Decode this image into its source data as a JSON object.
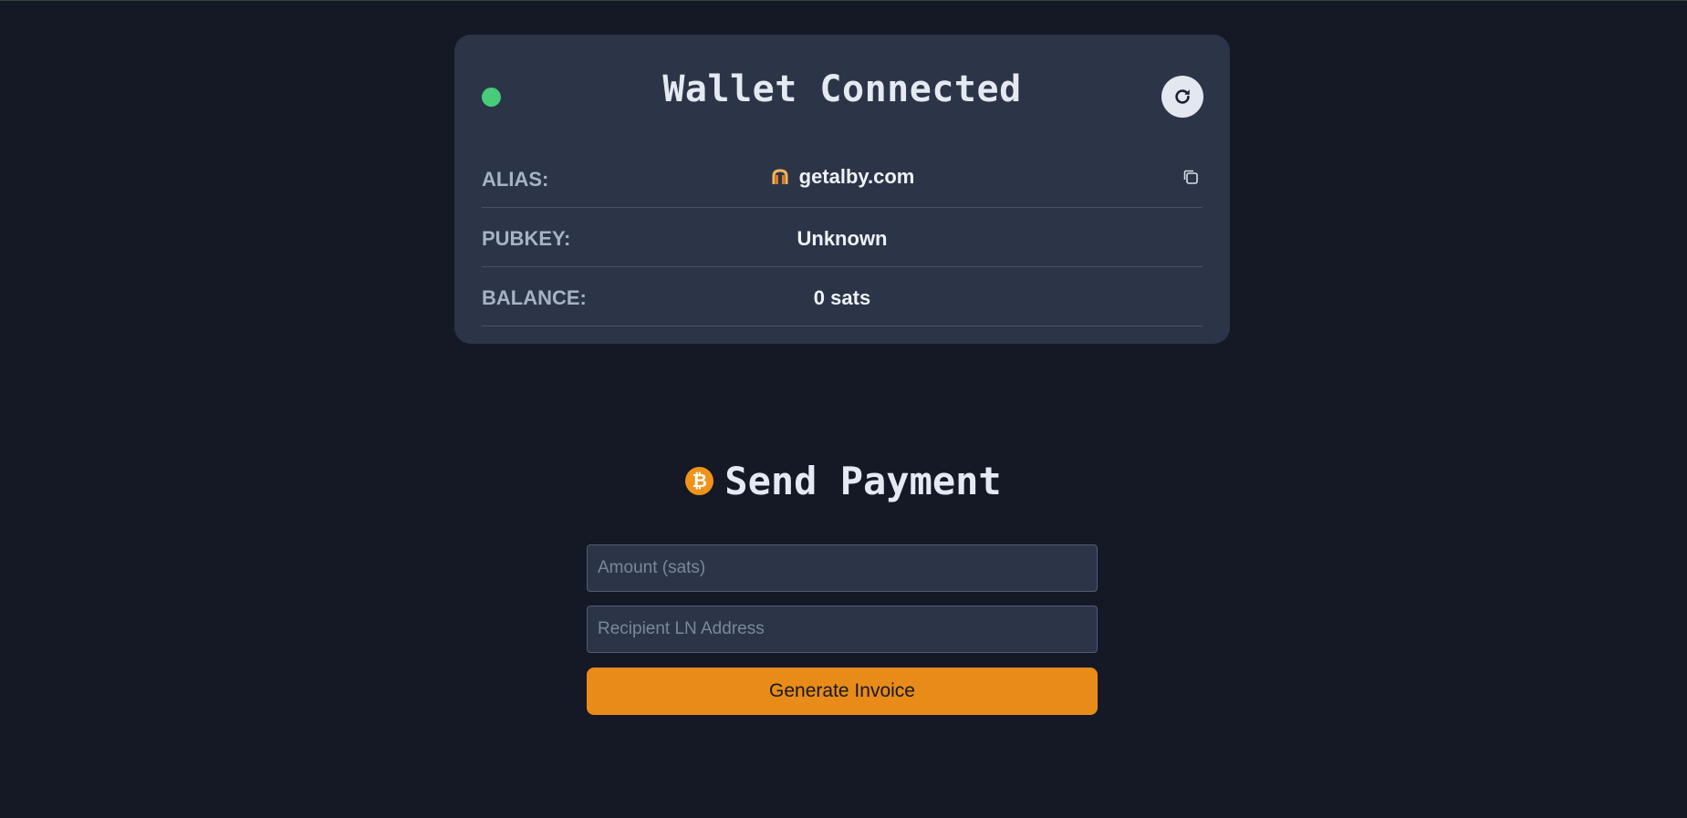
{
  "wallet": {
    "status": "connected",
    "title": "Wallet Connected",
    "status_color": "#47cc79",
    "refresh_icon": "refresh-icon",
    "rows": [
      {
        "label": "ALIAS:",
        "value": "getalby.com",
        "icon": "alby-logo-icon",
        "copy_icon": "copy-icon"
      },
      {
        "label": "PUBKEY:",
        "value": "Unknown"
      },
      {
        "label": "BALANCE:",
        "value": "0 sats"
      }
    ]
  },
  "send": {
    "title": "Send Payment",
    "icon": "bitcoin-icon",
    "icon_glyph": "₿",
    "amount_placeholder": "Amount (sats)",
    "address_placeholder": "Recipient LN Address",
    "button_label": "Generate Invoice",
    "accent_color": "#e98b19"
  }
}
